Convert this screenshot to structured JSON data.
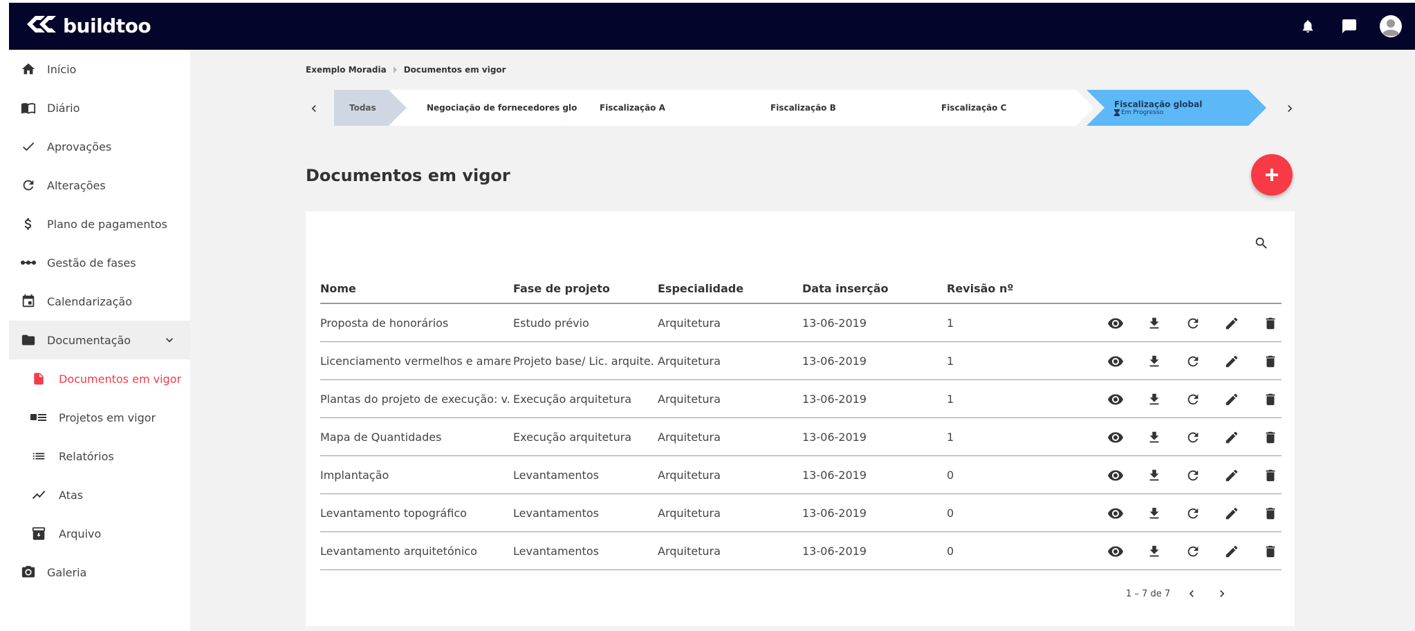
{
  "app": {
    "logo_text": "buildtoo",
    "top_icons": [
      "bell-icon",
      "chat-icon",
      "avatar"
    ]
  },
  "sidebar": {
    "items": [
      {
        "label": "Início",
        "icon": "home-icon"
      },
      {
        "label": "Diário",
        "icon": "book-icon"
      },
      {
        "label": "Aprovações",
        "icon": "check-icon"
      },
      {
        "label": "Alterações",
        "icon": "refresh-icon"
      },
      {
        "label": "Plano de pagamentos",
        "icon": "dollar-icon"
      },
      {
        "label": "Gestão de fases",
        "icon": "timeline-icon"
      },
      {
        "label": "Calendarização",
        "icon": "calendar-icon"
      },
      {
        "label": "Documentação",
        "icon": "folder-icon"
      },
      {
        "label": "Documentos em vigor",
        "icon": "file-icon"
      },
      {
        "label": "Projetos em vigor",
        "icon": "id-card-icon"
      },
      {
        "label": "Relatórios",
        "icon": "list-icon"
      },
      {
        "label": "Atas",
        "icon": "trending-icon"
      },
      {
        "label": "Arquivo",
        "icon": "archive-icon"
      },
      {
        "label": "Galeria",
        "icon": "camera-icon"
      }
    ]
  },
  "breadcrumb": {
    "items": [
      "Exemplo Moradia",
      "Documentos em vigor"
    ]
  },
  "stepper": {
    "steps": [
      {
        "label": "Todas"
      },
      {
        "label": "Negociação de fornecedores glo..."
      },
      {
        "label": "Fiscalização A"
      },
      {
        "label": "Fiscalização B"
      },
      {
        "label": "Fiscalização C"
      },
      {
        "label": "Fiscalização global",
        "status": "Em Progresso"
      }
    ]
  },
  "page": {
    "title": "Documentos em vigor",
    "add_icon": "plus-icon"
  },
  "table": {
    "columns": [
      "Nome",
      "Fase de projeto",
      "Especialidade",
      "Data inserção",
      "Revisão nº"
    ],
    "rows": [
      [
        "Proposta de honorários",
        "Estudo prévio",
        "Arquitetura",
        "13-06-2019",
        "1"
      ],
      [
        "Licenciamento vermelhos e amare...",
        "Projeto base/ Lic. arquite...",
        "Arquitetura",
        "13-06-2019",
        "1"
      ],
      [
        "Plantas do projeto de execução: v...",
        "Execução arquitetura",
        "Arquitetura",
        "13-06-2019",
        "1"
      ],
      [
        "Mapa de Quantidades",
        "Execução arquitetura",
        "Arquitetura",
        "13-06-2019",
        "1"
      ],
      [
        "Implantação",
        "Levantamentos",
        "Arquitetura",
        "13-06-2019",
        "0"
      ],
      [
        "Levantamento topográfico",
        "Levantamentos",
        "Arquitetura",
        "13-06-2019",
        "0"
      ],
      [
        "Levantamento arquitetónico",
        "Levantamentos",
        "Arquitetura",
        "13-06-2019",
        "0"
      ]
    ],
    "row_actions": [
      "eye-icon",
      "download-icon",
      "refresh-icon",
      "pencil-icon",
      "trash-icon"
    ]
  },
  "pagination": {
    "label": "1 – 7 de 7"
  },
  "colors": {
    "topbar": "#03052a",
    "accent_red": "#f73a45",
    "step_active": "#5cb8f7",
    "step_todas": "#cfd8e2"
  }
}
